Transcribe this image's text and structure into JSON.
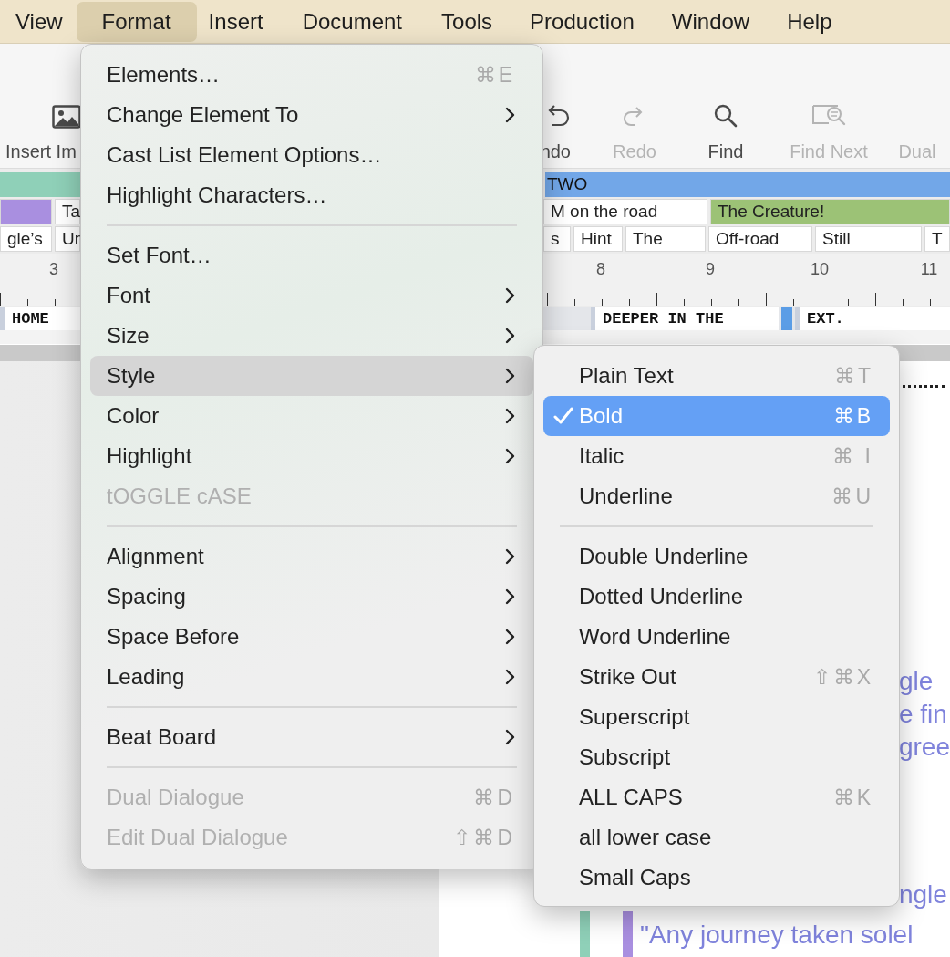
{
  "menu_bar": [
    {
      "label": "View",
      "selected": false
    },
    {
      "label": "Format",
      "selected": true
    },
    {
      "label": "Insert",
      "selected": false
    },
    {
      "label": "Document",
      "selected": false
    },
    {
      "label": "Tools",
      "selected": false
    },
    {
      "label": "Production",
      "selected": false
    },
    {
      "label": "Window",
      "selected": false
    },
    {
      "label": "Help",
      "selected": false
    }
  ],
  "toolbar": [
    {
      "kind": "image",
      "label": "Insert Im",
      "disabled": false
    },
    {
      "kind": "undo",
      "label": "ndo",
      "disabled": false
    },
    {
      "kind": "redo",
      "label": "Redo",
      "disabled": true
    },
    {
      "kind": "search",
      "label": "Find",
      "disabled": false
    },
    {
      "kind": "find-next",
      "label": "Find Next",
      "disabled": true
    },
    {
      "label": "Dual",
      "disabled": true
    }
  ],
  "beat_board": {
    "acts": [
      {
        "color": "#8fd0b8"
      },
      {
        "label": "TWO",
        "color": "#72a7e8"
      }
    ],
    "beats": [
      {
        "color": "#a98fe0"
      },
      {
        "label": "Ta"
      },
      {
        "label": "M on the road"
      },
      {
        "label": "The Creature!",
        "color": "#9cc276"
      }
    ],
    "cards": [
      {
        "label": "gle’s"
      },
      {
        "label": "Ur"
      },
      {
        "label": "s"
      },
      {
        "label": "Hint"
      },
      {
        "label": "The"
      },
      {
        "label": "Off-road"
      },
      {
        "label": "Still"
      },
      {
        "label": "T"
      }
    ]
  },
  "ruler": [
    "3",
    "8",
    "9",
    "10",
    "11"
  ],
  "scene_strip": [
    {
      "kind": "scene",
      "title": "HOME"
    },
    {
      "kind": "scene",
      "title": "DEEPER IN THE"
    },
    {
      "kind": "marker",
      "color": "#5b9de6"
    },
    {
      "kind": "scene",
      "title": "EXT."
    }
  ],
  "script": [
    {
      "text": "gle"
    },
    {
      "text": "e fin"
    },
    {
      "text": "gree"
    },
    {
      "text": "ngle"
    },
    {
      "text": "\"Any journey taken solel"
    }
  ],
  "format_menu": {
    "items": [
      {
        "kind": "item",
        "label": "Elements…",
        "shortcut": "⌘E",
        "disabled": false,
        "selected": false
      },
      {
        "kind": "submenu",
        "label": "Change Element To",
        "disabled": false,
        "selected": false
      },
      {
        "kind": "item",
        "label": "Cast List Element Options…",
        "disabled": false,
        "selected": false
      },
      {
        "kind": "item",
        "label": "Highlight Characters…",
        "disabled": false,
        "selected": false
      },
      {
        "kind": "separator"
      },
      {
        "kind": "item",
        "label": "Set Font…",
        "disabled": false,
        "selected": false
      },
      {
        "kind": "submenu",
        "label": "Font",
        "disabled": false,
        "selected": false
      },
      {
        "kind": "submenu",
        "label": "Size",
        "disabled": false,
        "selected": false
      },
      {
        "kind": "submenu",
        "label": "Style",
        "disabled": false,
        "selected": true
      },
      {
        "kind": "submenu",
        "label": "Color",
        "disabled": false,
        "selected": false
      },
      {
        "kind": "submenu",
        "label": "Highlight",
        "disabled": false,
        "selected": false
      },
      {
        "kind": "item",
        "label": "tOGGLE cASE",
        "disabled": true,
        "selected": false
      },
      {
        "kind": "separator"
      },
      {
        "kind": "submenu",
        "label": "Alignment",
        "disabled": false,
        "selected": false
      },
      {
        "kind": "submenu",
        "label": "Spacing",
        "disabled": false,
        "selected": false
      },
      {
        "kind": "submenu",
        "label": "Space Before",
        "disabled": false,
        "selected": false
      },
      {
        "kind": "submenu",
        "label": "Leading",
        "disabled": false,
        "selected": false
      },
      {
        "kind": "separator"
      },
      {
        "kind": "submenu",
        "label": "Beat Board",
        "disabled": false,
        "selected": false
      },
      {
        "kind": "separator"
      },
      {
        "kind": "item",
        "label": "Dual Dialogue",
        "shortcut": "⌘D",
        "disabled": true,
        "selected": false
      },
      {
        "kind": "item",
        "label": "Edit Dual Dialogue",
        "shortcut": "⇧⌘D",
        "disabled": true,
        "selected": false
      }
    ]
  },
  "style_submenu": {
    "items": [
      {
        "kind": "item",
        "label": "Plain Text",
        "shortcut": "⌘T",
        "checked": false,
        "selected": false
      },
      {
        "kind": "item",
        "label": "Bold",
        "shortcut": "⌘B",
        "checked": true,
        "selected": true
      },
      {
        "kind": "item",
        "label": "Italic",
        "shortcut": "⌘ I",
        "checked": false,
        "selected": false
      },
      {
        "kind": "item",
        "label": "Underline",
        "shortcut": "⌘U",
        "checked": false,
        "selected": false
      },
      {
        "kind": "separator"
      },
      {
        "kind": "item",
        "label": "Double Underline",
        "checked": false,
        "selected": false
      },
      {
        "kind": "item",
        "label": "Dotted Underline",
        "checked": false,
        "selected": false
      },
      {
        "kind": "item",
        "label": "Word Underline",
        "checked": false,
        "selected": false
      },
      {
        "kind": "item",
        "label": "Strike Out",
        "shortcut": "⇧⌘X",
        "checked": false,
        "selected": false
      },
      {
        "kind": "item",
        "label": "Superscript",
        "checked": false,
        "selected": false
      },
      {
        "kind": "item",
        "label": "Subscript",
        "checked": false,
        "selected": false
      },
      {
        "kind": "item",
        "label": "ALL CAPS",
        "shortcut": "⌘K",
        "checked": false,
        "selected": false
      },
      {
        "kind": "item",
        "label": "all lower case",
        "checked": false,
        "selected": false
      },
      {
        "kind": "item",
        "label": "Small Caps",
        "checked": false,
        "selected": false
      }
    ]
  }
}
